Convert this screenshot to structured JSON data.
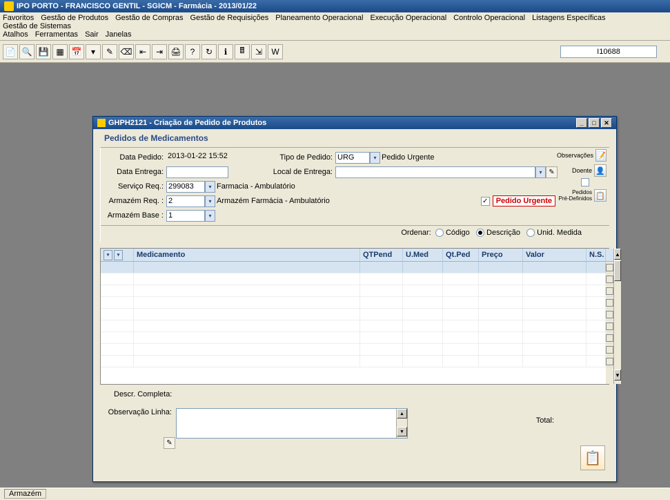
{
  "main_title": "IPO PORTO - FRANCISCO GENTIL  -  SGICM - Farmácia  -  2013/01/22",
  "menus": [
    "Favoritos",
    "Gestão de Produtos",
    "Gestão de Compras",
    "Gestão de Requisições",
    "Planeamento Operacional",
    "Execução Operacional",
    "Controlo Operacional",
    "Listagens Específicas",
    "Gestão de Sistemas",
    "Atalhos",
    "Ferramentas",
    "Sair",
    "Janelas"
  ],
  "toolbar_field": "I10688",
  "window": {
    "title": "GHPH2121 - Criação de Pedido de Produtos",
    "panel_title": "Pedidos de Medicamentos",
    "labels": {
      "data_pedido": "Data Pedido:",
      "data_entrega": "Data Entrega:",
      "servico_req": "Serviço Req.:",
      "armazem_req": "Armazém Req. :",
      "armazem_base": "Armazém Base :",
      "tipo_pedido": "Tipo de Pedido:",
      "local_entrega": "Local de Entrega:",
      "pedido_urgente": "Pedido Urgente",
      "ordenar": "Ordenar:",
      "descr_completa": "Descr. Completa:",
      "observacao_linha": "Observação Linha:",
      "total": "Total:"
    },
    "values": {
      "data_pedido": "2013-01-22 15:52",
      "data_entrega": "",
      "servico_req": "299083",
      "servico_req_desc": "Farmacia - Ambulatório",
      "armazem_req": "2",
      "armazem_req_desc": "Armazém Farmácia - Ambulatório",
      "armazem_base": "1",
      "tipo_pedido": "URG",
      "tipo_pedido_desc": "Pedido Urgente",
      "local_entrega": "",
      "pedido_urgente_checked": true
    },
    "side": {
      "observacoes": "Observações",
      "doente": "Doente",
      "pedidos_pre": "Pedidos\nPré-Definidos"
    },
    "ordenar_opts": {
      "codigo": "Código",
      "descricao": "Descrição",
      "unid": "Unid. Medida",
      "selected": "descricao"
    },
    "table": {
      "headers": {
        "medicamento": "Medicamento",
        "qtpend": "QTPend",
        "umed": "U.Med",
        "qtped": "Qt.Ped",
        "preco": "Preço",
        "valor": "Valor",
        "ns": "N.S."
      },
      "rows": [
        {
          "med": "",
          "qtpend": "",
          "umed": "",
          "qtped": "",
          "preco": "",
          "valor": ""
        },
        {
          "med": "",
          "qtpend": "",
          "umed": "",
          "qtped": "",
          "preco": "",
          "valor": ""
        },
        {
          "med": "",
          "qtpend": "",
          "umed": "",
          "qtped": "",
          "preco": "",
          "valor": ""
        },
        {
          "med": "",
          "qtpend": "",
          "umed": "",
          "qtped": "",
          "preco": "",
          "valor": ""
        },
        {
          "med": "",
          "qtpend": "",
          "umed": "",
          "qtped": "",
          "preco": "",
          "valor": ""
        },
        {
          "med": "",
          "qtpend": "",
          "umed": "",
          "qtped": "",
          "preco": "",
          "valor": ""
        },
        {
          "med": "",
          "qtpend": "",
          "umed": "",
          "qtped": "",
          "preco": "",
          "valor": ""
        },
        {
          "med": "",
          "qtpend": "",
          "umed": "",
          "qtped": "",
          "preco": "",
          "valor": ""
        },
        {
          "med": "",
          "qtpend": "",
          "umed": "",
          "qtped": "",
          "preco": "",
          "valor": ""
        }
      ]
    }
  },
  "status": "Armazém"
}
